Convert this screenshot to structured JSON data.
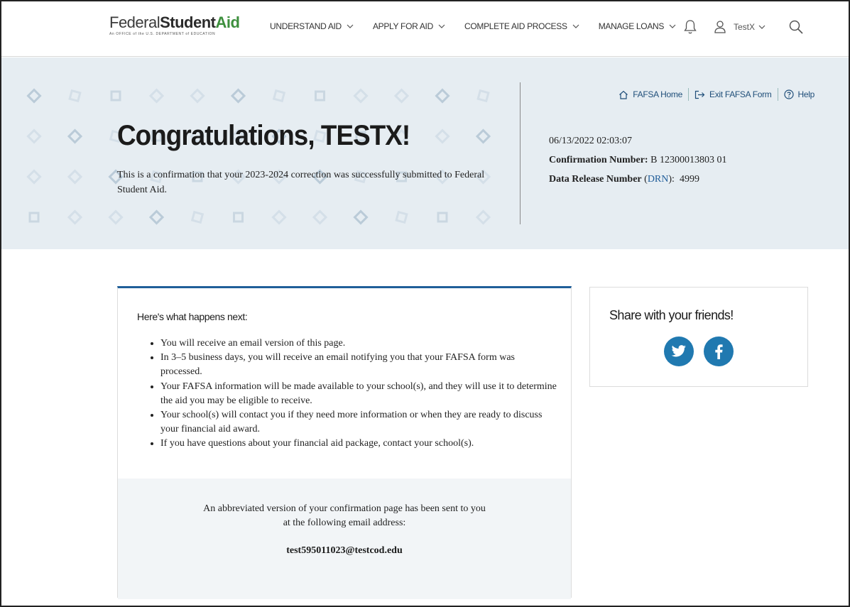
{
  "header": {
    "logo_main_1": "Federal",
    "logo_main_2": "Student",
    "logo_main_3": "Aid",
    "logo_sub": "An OFFICE of the U.S. DEPARTMENT of EDUCATION",
    "nav": [
      {
        "label": "UNDERSTAND AID"
      },
      {
        "label": "APPLY FOR AID"
      },
      {
        "label": "COMPLETE AID PROCESS"
      },
      {
        "label": "MANAGE LOANS"
      }
    ],
    "user_label": "TestX"
  },
  "hero": {
    "title": "Congratulations, TESTX!",
    "message": "This is a confirmation that your 2023-2024 correction was successfully submitted to Federal Student Aid.",
    "links": {
      "home": "FAFSA Home",
      "exit": "Exit FAFSA Form",
      "help": "Help"
    },
    "timestamp": "06/13/2022 02:03:07",
    "confirmation_label": "Confirmation Number:",
    "confirmation_value": "B 12300013803 01",
    "drn_label": "Data Release Number",
    "drn_abbr": "DRN",
    "drn_value": "4999"
  },
  "next_steps": {
    "heading": "Here's what happens next:",
    "items": [
      "You will receive an email version of this page.",
      "In 3–5 business days, you will receive an email notifying you that your FAFSA form was processed.",
      "Your FAFSA information will be made available to your school(s), and they will use it to determine the aid you may be eligible to receive.",
      "Your school(s) will contact you if they need more information or when they are ready to discuss your financial aid award.",
      "If you have questions about your financial aid package, contact your school(s)."
    ],
    "email_note_1": "An abbreviated version of your confirmation page has been sent to you",
    "email_note_2": "at the following email address:",
    "email": "test595011023@testcod.edu"
  },
  "share": {
    "title": "Share with your friends!"
  },
  "colors": {
    "brand_blue": "#1f5f99",
    "social_blue": "#2079b0",
    "hero_bg": "#e6edf2",
    "logo_green": "#3d8f3d"
  }
}
